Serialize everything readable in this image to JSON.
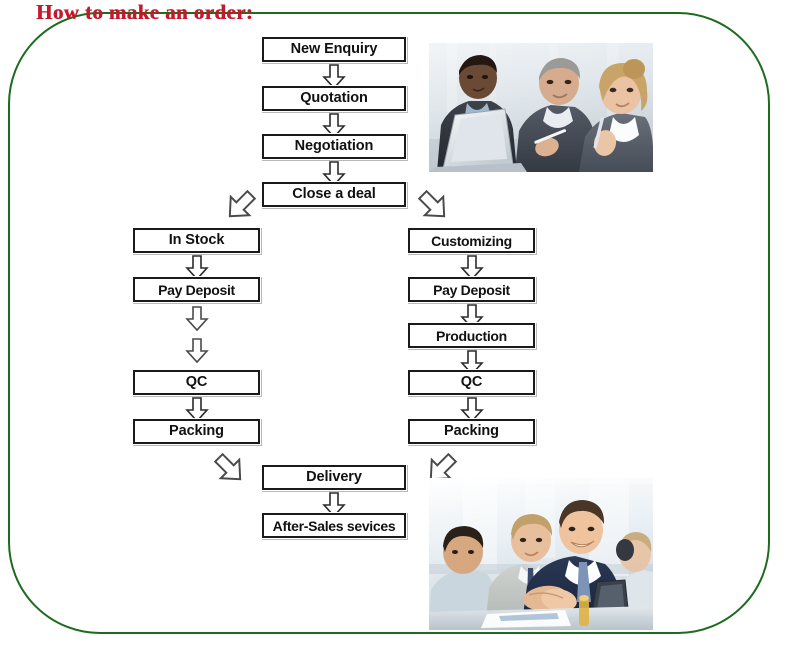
{
  "page": {
    "title": "How to make an order:",
    "frame_color": "#1d6b1d",
    "title_color": "#c2192b",
    "background": "#ffffff"
  },
  "flowchart": {
    "type": "flowchart",
    "orientation": "top-to-bottom",
    "main_sequence": [
      {
        "id": "new-enquiry",
        "label": "New Enquiry"
      },
      {
        "id": "quotation",
        "label": "Quotation"
      },
      {
        "id": "negotiation",
        "label": "Negotiation"
      },
      {
        "id": "close-a-deal",
        "label": "Close a deal"
      }
    ],
    "branches": [
      {
        "id": "in-stock-branch",
        "side": "left",
        "steps": [
          {
            "id": "in-stock",
            "label": "In Stock"
          },
          {
            "id": "pay-deposit-left",
            "label": "Pay Deposit"
          },
          {
            "id": "qc-left",
            "label": "QC"
          },
          {
            "id": "packing-left",
            "label": "Packing"
          }
        ]
      },
      {
        "id": "customizing-branch",
        "side": "right",
        "steps": [
          {
            "id": "customizing",
            "label": "Customizing"
          },
          {
            "id": "pay-deposit-right",
            "label": "Pay Deposit"
          },
          {
            "id": "production",
            "label": "Production"
          },
          {
            "id": "qc-right",
            "label": "QC"
          },
          {
            "id": "packing-right",
            "label": "Packing"
          }
        ]
      }
    ],
    "merge_sequence": [
      {
        "id": "delivery",
        "label": "Delivery"
      },
      {
        "id": "after-sales-services",
        "label": "After-Sales sevices"
      }
    ],
    "connector_icons": {
      "down": "arrow-down-icon",
      "branch_left": "arrow-diagonal-down-left-icon",
      "branch_right": "arrow-diagonal-down-right-icon",
      "merge_left": "arrow-diagonal-down-right-icon",
      "merge_right": "arrow-diagonal-down-left-icon"
    }
  },
  "photos": [
    {
      "id": "photo-business-meeting",
      "caption": "Three business people reviewing a laptop together",
      "position": "top-right"
    },
    {
      "id": "photo-handshake",
      "caption": "Business people shaking hands across a table",
      "position": "bottom-right"
    }
  ]
}
